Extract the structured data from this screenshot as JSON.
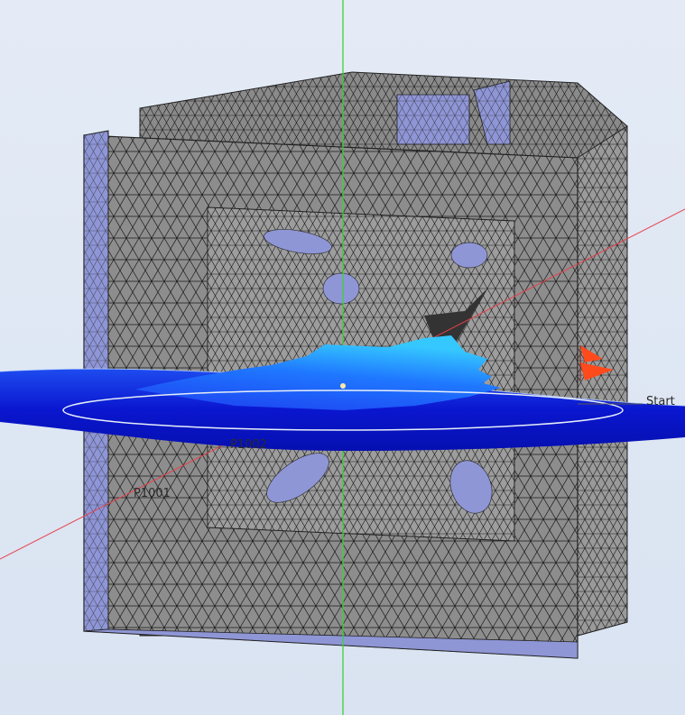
{
  "viewport": {
    "labels": {
      "start": "Start",
      "p1001": "P1001",
      "p1002": "P1002"
    },
    "colors": {
      "background": "#dde6f3",
      "mesh_fill": "#8a8a8a",
      "mesh_lines": "#1a1a1a",
      "blue_faces": "#8f96d6",
      "field_plot_dark": "#0a14c8",
      "field_plot_light": "#2ea0ff",
      "vertical_axis": "#3cd23c",
      "ray_axis": "#e8414b",
      "probe_marker": "#ff4a1c"
    }
  }
}
